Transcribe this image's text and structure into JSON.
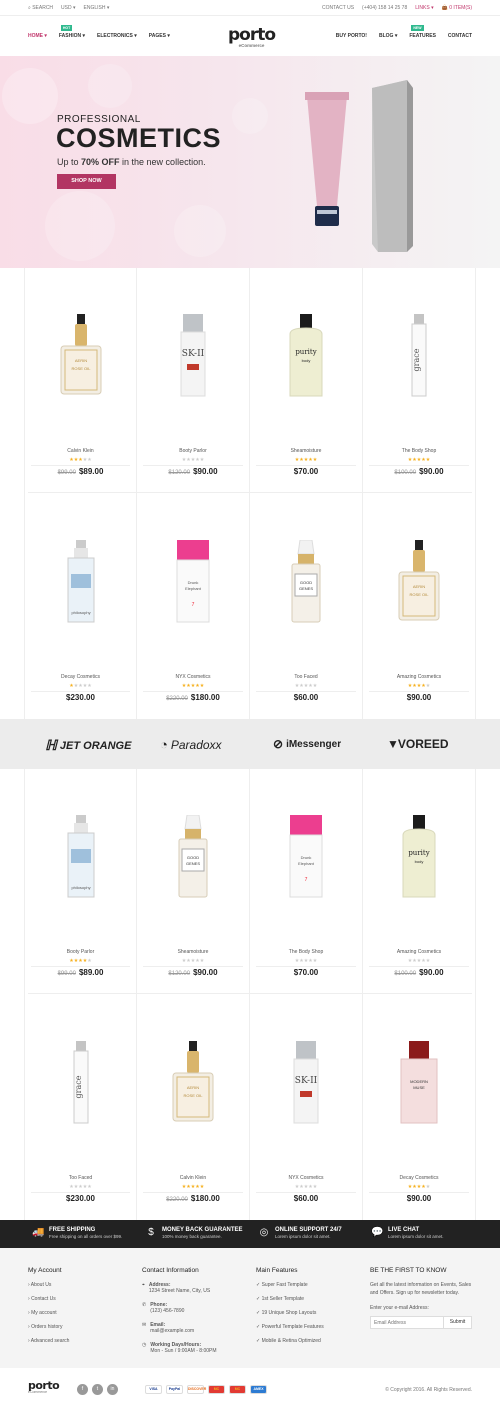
{
  "topbar": {
    "search": "SEARCH",
    "currency": "USD",
    "language": "ENGLISH",
    "contact": "CONTACT US",
    "phone": "(+404) 158 14 25 78",
    "links": "LINKS",
    "cart": "0 ITEM(S)"
  },
  "nav_left": [
    {
      "label": "HOME",
      "active": true
    },
    {
      "label": "FASHION",
      "badge": "HOT"
    },
    {
      "label": "ELECTRONICS"
    },
    {
      "label": "PAGES"
    }
  ],
  "nav_right": [
    {
      "label": "BUY PORTO!"
    },
    {
      "label": "BLOG"
    },
    {
      "label": "FEATURES",
      "badge": "NEW"
    },
    {
      "label": "CONTACT"
    }
  ],
  "logo": {
    "word": "porto",
    "sub": "eCommerce"
  },
  "hero": {
    "line1": "PROFESSIONAL",
    "line2": "COSMETICS",
    "line3_pre": "Up to ",
    "line3_bold": "70% OFF",
    "line3_post": " in the new collection.",
    "button": "SHOP NOW"
  },
  "products": [
    {
      "name": "Calvin Klein",
      "old": "$99.00",
      "price": "$89.00",
      "rating": 3,
      "img": "aerin"
    },
    {
      "name": "Booty Parlor",
      "old": "$120.00",
      "price": "$90.00",
      "rating": 0,
      "img": "skii"
    },
    {
      "name": "Sheamoisture",
      "old": "",
      "price": "$70.00",
      "rating": 5,
      "img": "purity"
    },
    {
      "name": "The Body Shop",
      "old": "$100.00",
      "price": "$90.00",
      "rating": 5,
      "img": "grace"
    },
    {
      "name": "Decay Cosmetics",
      "old": "",
      "price": "$230.00",
      "rating": 1,
      "img": "philo"
    },
    {
      "name": "NYX Cosmetics",
      "old": "$220.00",
      "price": "$180.00",
      "rating": 5,
      "img": "pink"
    },
    {
      "name": "Too Faced",
      "old": "",
      "price": "$60.00",
      "rating": 0,
      "img": "genes"
    },
    {
      "name": "Amazing Cosmetics",
      "old": "",
      "price": "$90.00",
      "rating": 4,
      "img": "aerin"
    },
    {
      "name": "Booty Parlor",
      "old": "$99.00",
      "price": "$89.00",
      "rating": 4,
      "img": "philo"
    },
    {
      "name": "Sheamoisture",
      "old": "$120.00",
      "price": "$90.00",
      "rating": 0,
      "img": "genes"
    },
    {
      "name": "The Body Shop",
      "old": "",
      "price": "$70.00",
      "rating": 0,
      "img": "pink"
    },
    {
      "name": "Amazing Cosmetics",
      "old": "$100.00",
      "price": "$90.00",
      "rating": 0,
      "img": "purity"
    },
    {
      "name": "Too Faced",
      "old": "",
      "price": "$230.00",
      "rating": 0,
      "img": "grace"
    },
    {
      "name": "Calvin Klein",
      "old": "$220.00",
      "price": "$180.00",
      "rating": 5,
      "img": "aerin"
    },
    {
      "name": "NYX Cosmetics",
      "old": "",
      "price": "$60.00",
      "rating": 0,
      "img": "skii"
    },
    {
      "name": "Decay Cosmetics",
      "old": "",
      "price": "$90.00",
      "rating": 4,
      "img": "muse"
    }
  ],
  "brands": [
    "JET ORANGE",
    "Paradoxx",
    "iMessenger",
    "VOREED"
  ],
  "features": [
    {
      "title": "FREE SHIPPING",
      "desc": "Free shipping on all orders over $99.",
      "icon": "truck-icon"
    },
    {
      "title": "MONEY BACK GUARANTEE",
      "desc": "100% money back guarantee.",
      "icon": "dollar-icon"
    },
    {
      "title": "ONLINE SUPPORT 24/7",
      "desc": "Lorem ipsum dolor sit amet.",
      "icon": "lifebuoy-icon"
    },
    {
      "title": "LIVE CHAT",
      "desc": "Lorem ipsum dolor sit amet.",
      "icon": "chat-icon"
    }
  ],
  "footer": {
    "account": {
      "title": "My Account",
      "links": [
        "About Us",
        "Contact Us",
        "My account",
        "Orders history",
        "Advanced search"
      ]
    },
    "contact": {
      "title": "Contact Information",
      "address_label": "Address:",
      "address": "1234 Street Name, City, US",
      "phone_label": "Phone:",
      "phone": "(123) 456-7890",
      "email_label": "Email:",
      "email": "mail@example.com",
      "hours_label": "Working Days/Hours:",
      "hours": "Mon - Sun / 9:00AM - 8:00PM"
    },
    "features": {
      "title": "Main Features",
      "items": [
        "Super Fast Template",
        "1st Seller Template",
        "19 Unique Shop Layouts",
        "Powerful Template Features",
        "Mobile & Retina Optimized"
      ]
    },
    "newsletter": {
      "title": "BE THE FIRST TO KNOW",
      "text": "Get all the latest information on Events, Sales and Offers. Sign up for newsletter today.",
      "label": "Enter your e-mail Address:",
      "placeholder": "Email Address",
      "button": "Submit"
    }
  },
  "bottom": {
    "copyright": "© Copyright 2016. All Rights Reserved.",
    "payments": [
      "VISA",
      "PayPal",
      "DISCOVER",
      "MC",
      "MC",
      "AMEX"
    ],
    "social": [
      "f",
      "t",
      "in"
    ]
  },
  "colors": {
    "accent": "#c1376c",
    "button": "#b23563",
    "dark": "#222222",
    "star": "#f6b01e"
  }
}
